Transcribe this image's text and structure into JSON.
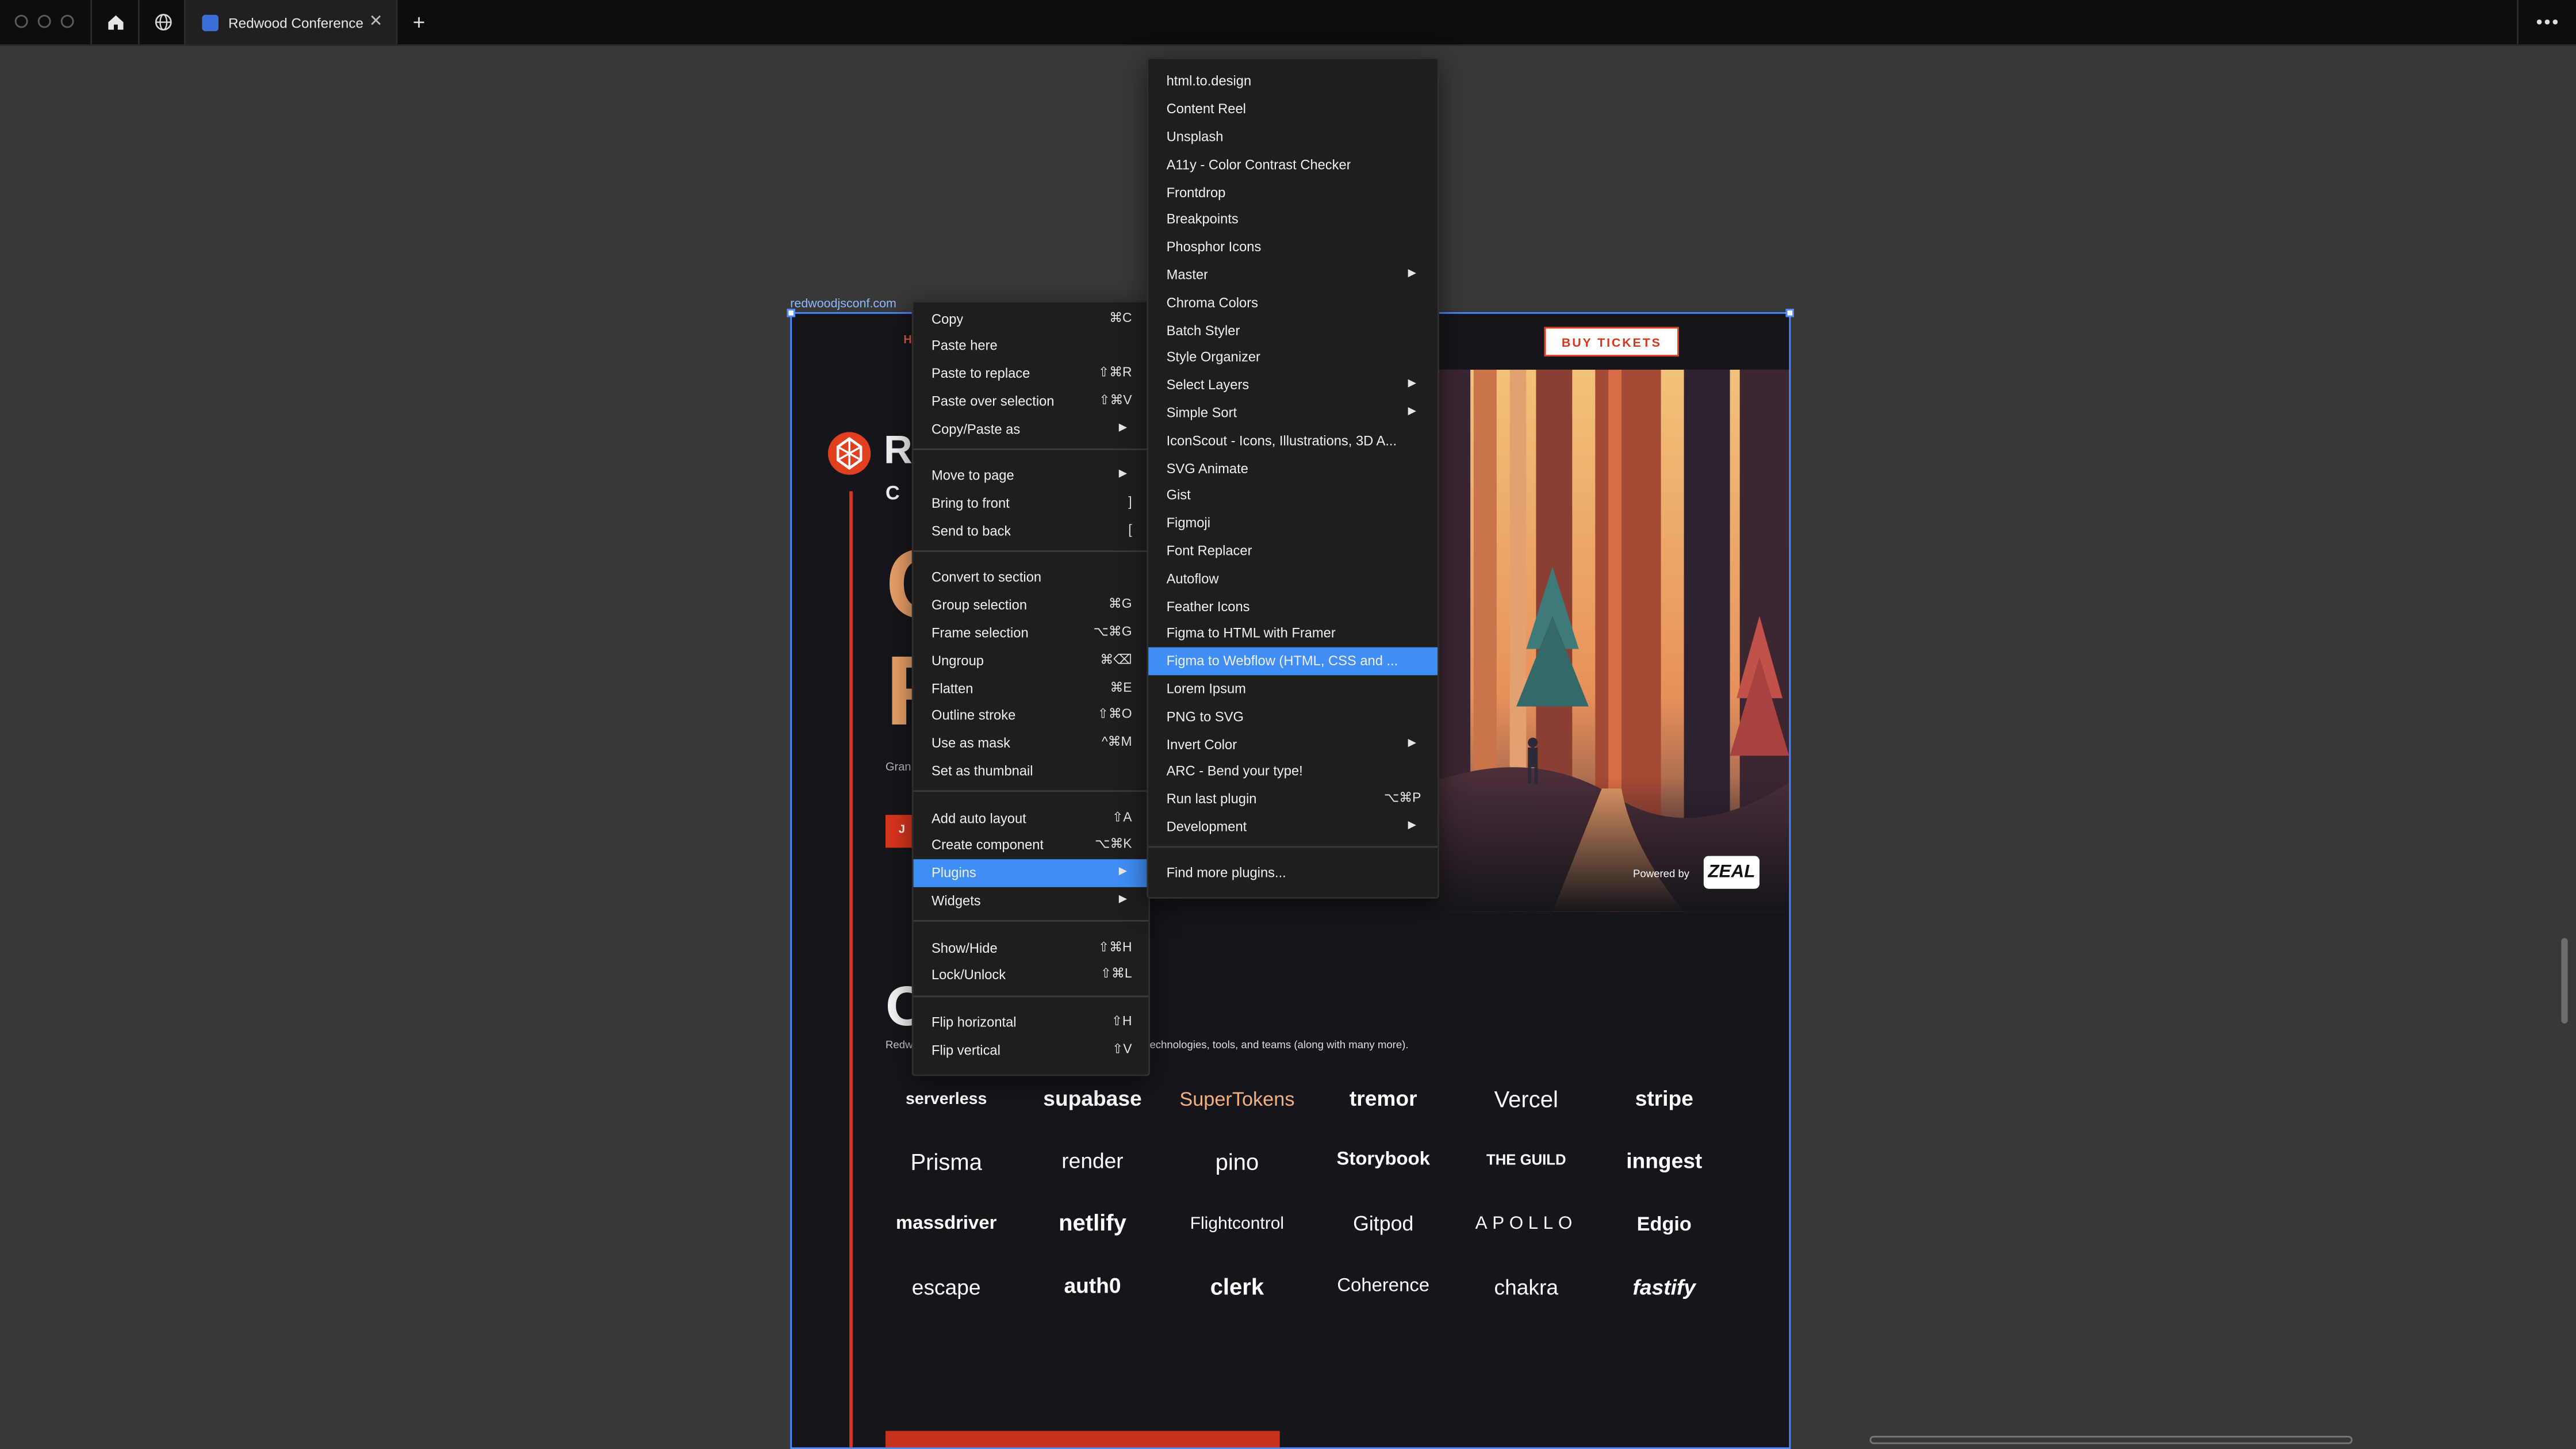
{
  "tab": {
    "title": "Redwood Conference"
  },
  "frame": {
    "label": "redwoodjsconf.com"
  },
  "site": {
    "nav_fragment": "H",
    "buy_tickets": "BUY TICKETS",
    "logo_fragment_1": "R",
    "logo_fragment_2": "C",
    "hero_c": "C",
    "hero_f": "F",
    "grant_fragment": "Gran",
    "join_fragment": "J",
    "section_fragment": "OU",
    "redw_fragment": "Redw",
    "sponsor_text": "technologies, tools, and teams (along with many more).",
    "powered_by": "Powered by",
    "zeal": "ZEAL",
    "partners": [
      "serverless",
      "supabase",
      "SuperTokens",
      "tremor",
      "Vercel",
      "stripe",
      "Prisma",
      "render",
      "pino",
      "Storybook",
      "THE GUILD",
      "inngest",
      "massdriver",
      "netlify",
      "Flightcontrol",
      "Gitpod",
      "APOLLO",
      "Edgio",
      "escape",
      "auth0",
      "clerk",
      "Coherence",
      "chakra",
      "fastify"
    ]
  },
  "context_menu": {
    "items": [
      {
        "label": "Copy",
        "shortcut": "⌘C"
      },
      {
        "label": "Paste here",
        "shortcut": ""
      },
      {
        "label": "Paste to replace",
        "shortcut": "⇧⌘R"
      },
      {
        "label": "Paste over selection",
        "shortcut": "⇧⌘V"
      },
      {
        "label": "Copy/Paste as",
        "shortcut": ""
      },
      {
        "label": "Move to page",
        "shortcut": ""
      },
      {
        "label": "Bring to front",
        "shortcut": "]"
      },
      {
        "label": "Send to back",
        "shortcut": "["
      },
      {
        "label": "Convert to section",
        "shortcut": ""
      },
      {
        "label": "Group selection",
        "shortcut": "⌘G"
      },
      {
        "label": "Frame selection",
        "shortcut": "⌥⌘G"
      },
      {
        "label": "Ungroup",
        "shortcut": "⌘⌫"
      },
      {
        "label": "Flatten",
        "shortcut": "⌘E"
      },
      {
        "label": "Outline stroke",
        "shortcut": "⇧⌘O"
      },
      {
        "label": "Use as mask",
        "shortcut": "^⌘M"
      },
      {
        "label": "Set as thumbnail",
        "shortcut": ""
      },
      {
        "label": "Add auto layout",
        "shortcut": "⇧A"
      },
      {
        "label": "Create component",
        "shortcut": "⌥⌘K"
      },
      {
        "label": "Plugins",
        "shortcut": ""
      },
      {
        "label": "Widgets",
        "shortcut": ""
      },
      {
        "label": "Show/Hide",
        "shortcut": "⇧⌘H"
      },
      {
        "label": "Lock/Unlock",
        "shortcut": "⇧⌘L"
      },
      {
        "label": "Flip horizontal",
        "shortcut": "⇧H"
      },
      {
        "label": "Flip vertical",
        "shortcut": "⇧V"
      }
    ]
  },
  "plugins_menu": {
    "items": [
      {
        "label": "html.to.design",
        "shortcut": ""
      },
      {
        "label": "Content Reel",
        "shortcut": ""
      },
      {
        "label": "Unsplash",
        "shortcut": ""
      },
      {
        "label": "A11y - Color Contrast Checker",
        "shortcut": ""
      },
      {
        "label": "Frontdrop",
        "shortcut": ""
      },
      {
        "label": "Breakpoints",
        "shortcut": ""
      },
      {
        "label": "Phosphor Icons",
        "shortcut": ""
      },
      {
        "label": "Master",
        "shortcut": ""
      },
      {
        "label": "Chroma Colors",
        "shortcut": ""
      },
      {
        "label": "Batch Styler",
        "shortcut": ""
      },
      {
        "label": "Style Organizer",
        "shortcut": ""
      },
      {
        "label": "Select Layers",
        "shortcut": ""
      },
      {
        "label": "Simple Sort",
        "shortcut": ""
      },
      {
        "label": "IconScout - Icons, Illustrations, 3D A...",
        "shortcut": ""
      },
      {
        "label": "SVG Animate",
        "shortcut": ""
      },
      {
        "label": "Gist",
        "shortcut": ""
      },
      {
        "label": "Figmoji",
        "shortcut": ""
      },
      {
        "label": "Font Replacer",
        "shortcut": ""
      },
      {
        "label": "Autoflow",
        "shortcut": ""
      },
      {
        "label": "Feather Icons",
        "shortcut": ""
      },
      {
        "label": "Figma to HTML with Framer",
        "shortcut": ""
      },
      {
        "label": "Figma to Webflow (HTML, CSS and ...",
        "shortcut": ""
      },
      {
        "label": "Lorem Ipsum",
        "shortcut": ""
      },
      {
        "label": "PNG to SVG",
        "shortcut": ""
      },
      {
        "label": "Invert Color",
        "shortcut": ""
      },
      {
        "label": "ARC - Bend your type!",
        "shortcut": ""
      },
      {
        "label": "Run last plugin",
        "shortcut": "⌥⌘P"
      },
      {
        "label": "Development",
        "shortcut": ""
      },
      {
        "label": "Find more plugins...",
        "shortcut": ""
      }
    ]
  },
  "colors": {
    "accent": "#3f8ef5",
    "brand_red": "#d9351e",
    "canvas": "#383838"
  }
}
